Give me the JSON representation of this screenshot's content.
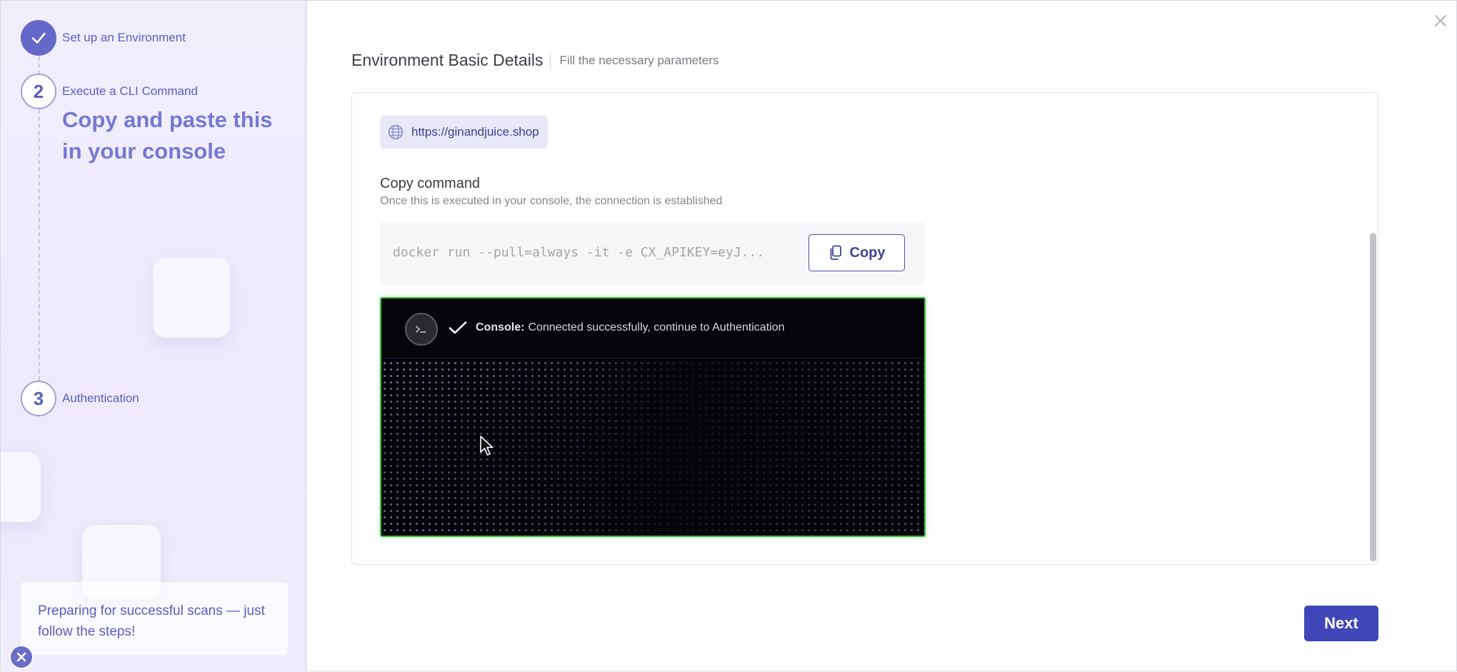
{
  "sidebar": {
    "steps": [
      {
        "number": "",
        "label": "Set up an Environment",
        "state": "done"
      },
      {
        "number": "2",
        "label": "Execute a CLI Command",
        "state": "active",
        "heading": "Copy and paste this in your console"
      },
      {
        "number": "3",
        "label": "Authentication",
        "state": "pending"
      }
    ],
    "tip": "Preparing for successful scans — just follow the steps!"
  },
  "main": {
    "title": "Environment Basic Details",
    "subtitle": "Fill the necessary parameters",
    "url": "https://ginandjuice.shop",
    "copy_command": {
      "title": "Copy command",
      "description": "Once this is executed in your console, the connection is established",
      "command": "docker run --pull=always -it -e CX_APIKEY=eyJ...",
      "copy_label": "Copy"
    },
    "console": {
      "label": "Console:",
      "message": "Connected successfully, continue to Authentication",
      "status_color": "#3dbb3d"
    },
    "next_label": "Next"
  },
  "icons": [
    "check-icon",
    "globe-icon",
    "copy-icon",
    "terminal-icon",
    "close-icon"
  ],
  "colors": {
    "accent": "#3f46b8",
    "sidebar_bg": "#f1eefc",
    "step_done": "#6468c9"
  }
}
